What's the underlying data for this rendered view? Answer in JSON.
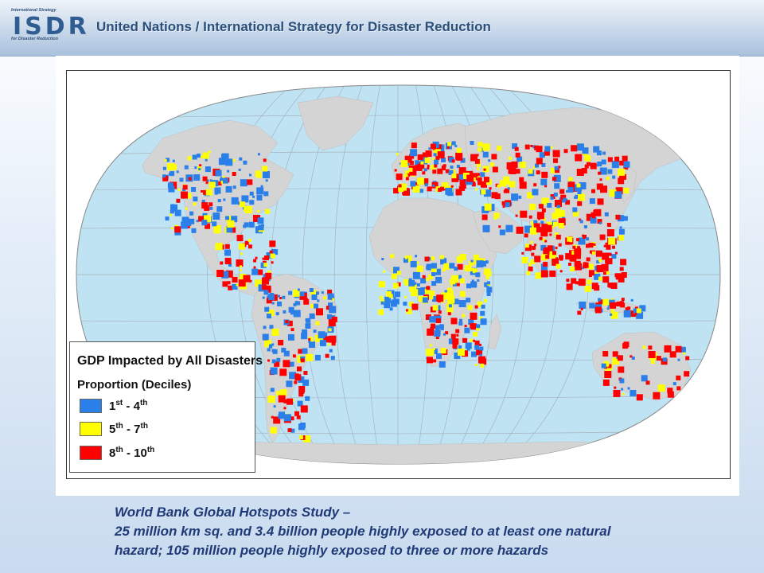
{
  "header": {
    "logo_text": "ISDR",
    "logo_small_top": "International Strategy",
    "logo_small_bottom": "for Disaster Reduction",
    "title": "United Nations / International Strategy for Disaster Reduction"
  },
  "legend": {
    "title": "GDP Impacted by All Disasters",
    "subtitle": "Proportion (Deciles)",
    "items": [
      {
        "start": "1",
        "start_sup": "st",
        "end": "4",
        "end_sup": "th",
        "color": "#2a7fe8"
      },
      {
        "start": "5",
        "start_sup": "th",
        "end": "7",
        "end_sup": "th",
        "color": "#ffff00"
      },
      {
        "start": "8",
        "start_sup": "th",
        "end": "10",
        "end_sup": "th",
        "color": "#ff0000"
      }
    ]
  },
  "map_colors": {
    "ocean": "#bfe3f3",
    "land": "#d4d4d4",
    "graticule": "#a7b3bd"
  },
  "caption": {
    "line1": "World Bank Global Hotspots Study –",
    "line2": "25 million km sq. and 3.4 billion people highly exposed to at least one natural",
    "line3": "hazard; 105 million people highly exposed to three or more hazards"
  }
}
